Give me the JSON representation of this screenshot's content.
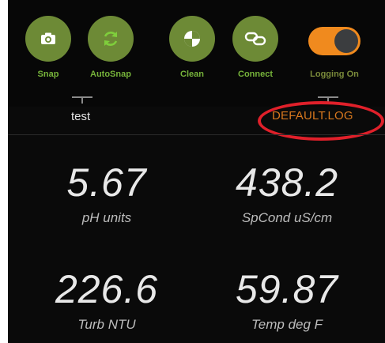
{
  "toolbar": {
    "buttons": [
      {
        "label": "Snap",
        "icon": "camera-icon"
      },
      {
        "label": "AutoSnap",
        "icon": "refresh-icon"
      },
      {
        "label": "Clean",
        "icon": "clean-icon"
      },
      {
        "label": "Connect",
        "icon": "link-icon"
      }
    ],
    "logging": {
      "label": "Logging On",
      "state": "on"
    }
  },
  "file": {
    "name": "test",
    "log": "DEFAULT.LOG"
  },
  "readings": [
    {
      "value": "5.67",
      "unit": "pH units"
    },
    {
      "value": "438.2",
      "unit": "SpCond uS/cm"
    },
    {
      "value": "226.6",
      "unit": "Turb NTU"
    },
    {
      "value": "59.87",
      "unit": "Temp deg F"
    }
  ],
  "colors": {
    "button_bg": "#6d8a36",
    "label_green": "#76b33a",
    "toggle_on": "#f08a1e",
    "log_orange": "#d8781e",
    "highlight_red": "#e0202a"
  }
}
